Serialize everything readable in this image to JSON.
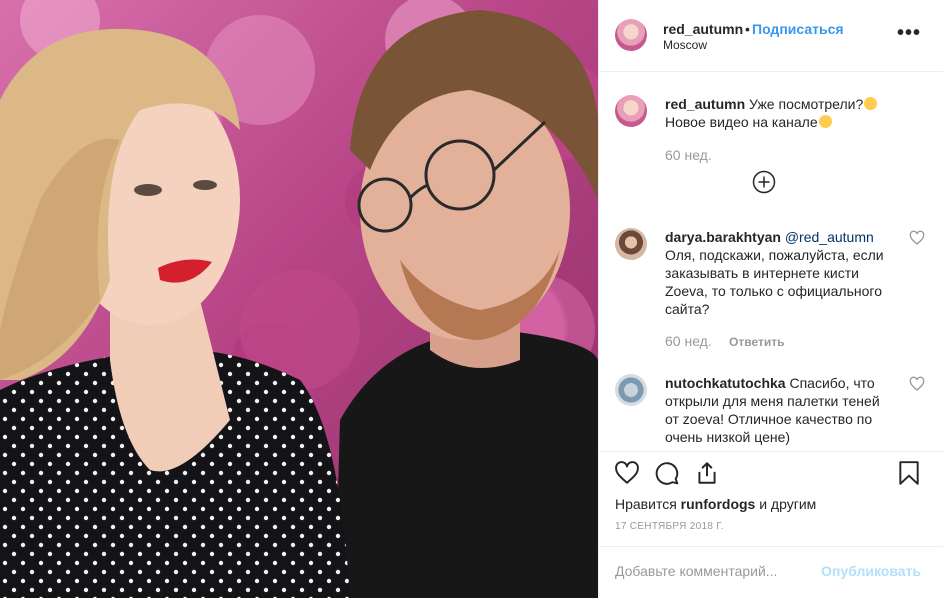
{
  "post": {
    "author": "red_autumn",
    "dot": "•",
    "follow_label": "Подписаться",
    "location": "Moscow",
    "more_label": "•••"
  },
  "caption": {
    "user": "red_autumn",
    "line1": "Уже посмотрели?",
    "line2": "Новое видео на канале",
    "time": "60 нед."
  },
  "comments": [
    {
      "user": "darya.barakhtyan",
      "mention": "@red_autumn",
      "text": "Оля, подскажи, пожалуйста, если заказывать в интернете кисти Zoeva, то только с официального сайта?",
      "time": "60 нед.",
      "reply_label": "Ответить"
    },
    {
      "user": "nutochkatutochka",
      "text": "Спасибо, что открыли для меня палетки теней от zoeva! Отличное качество по очень низкой цене)"
    }
  ],
  "likes": {
    "prefix": "Нравится",
    "user": "runfordogs",
    "suffix": "и другим"
  },
  "date": "17 СЕНТЯБРЯ 2018 Г.",
  "add_comment": {
    "placeholder": "Добавьте комментарий...",
    "publish_label": "Опубликовать"
  },
  "colors": {
    "link": "#3897f0",
    "publish_disabled": "#b2dffc",
    "muted": "#999999"
  },
  "icons": [
    "heart-icon",
    "comment-icon",
    "share-icon",
    "bookmark-icon",
    "plus-circle-icon",
    "more-icon"
  ]
}
